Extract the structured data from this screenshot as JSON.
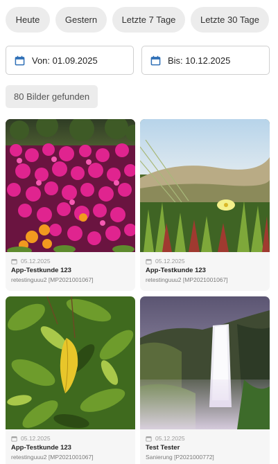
{
  "filters": {
    "chips": [
      "Heute",
      "Gestern",
      "Letzte 7 Tage",
      "Letzte 30 Tage"
    ]
  },
  "date_range": {
    "from_label": "Von: 01.09.2025",
    "to_label": "Bis: 10.12.2025",
    "icon": "calendar-icon"
  },
  "results": {
    "count_label": "80 Bilder gefunden"
  },
  "cards": [
    {
      "date": "05.12.2025",
      "title": "App-Testkunde 123",
      "subtitle": "retestinguuu2 [MP2021001067]",
      "image": "pink-flowers-photo"
    },
    {
      "date": "05.12.2025",
      "title": "App-Testkunde 123",
      "subtitle": "retestinguuu2 [MP2021001067]",
      "image": "dune-plants-photo"
    },
    {
      "date": "05.12.2025",
      "title": "App-Testkunde 123",
      "subtitle": "retestinguuu2 [MP2021001067]",
      "image": "green-leaves-photo"
    },
    {
      "date": "05.12.2025",
      "title": "Test Tester",
      "subtitle": "Sanierung [P2021000772]",
      "image": "waterfall-photo"
    }
  ],
  "colors": {
    "accent": "#2e6fb6",
    "chip_bg": "#ececec",
    "card_bg": "#f6f6f6"
  }
}
